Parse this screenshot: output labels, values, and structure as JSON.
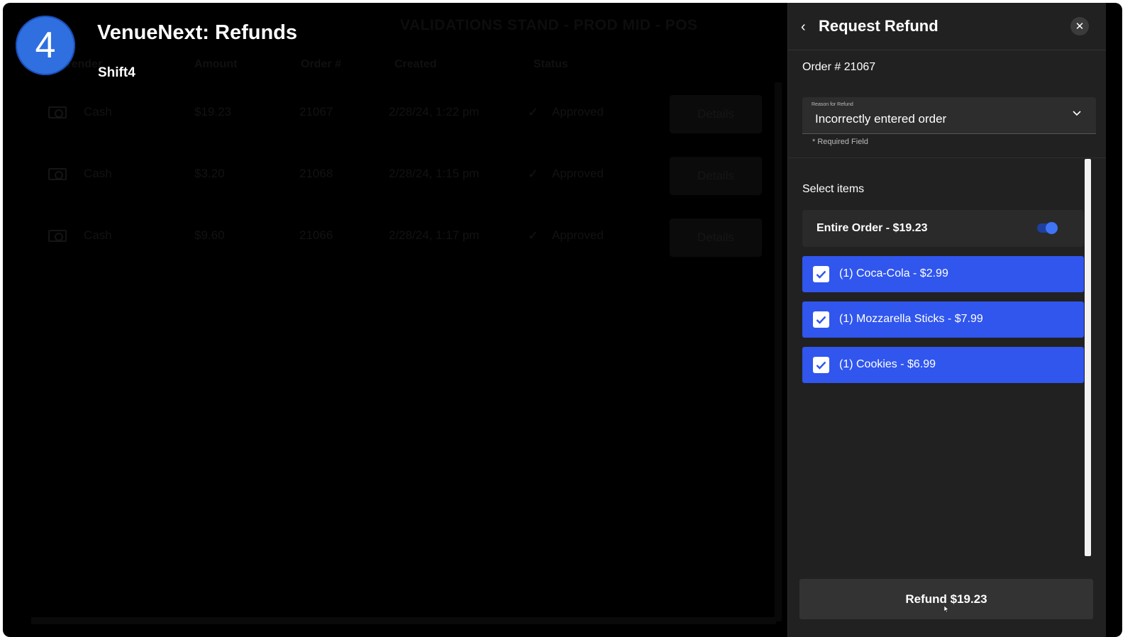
{
  "background": {
    "title": "VALIDATIONS STAND - PROD MID - POS",
    "columns": [
      "Tender",
      "Amount",
      "Order #",
      "Created",
      "Status"
    ],
    "rows": [
      {
        "tender": "Cash",
        "amount": "$19.23",
        "order": "21067",
        "created": "2/28/24, 1:22 pm",
        "status": "Approved",
        "action": "Details"
      },
      {
        "tender": "Cash",
        "amount": "$3.20",
        "order": "21068",
        "created": "2/28/24, 1:15 pm",
        "status": "Approved",
        "action": "Details"
      },
      {
        "tender": "Cash",
        "amount": "$9.60",
        "order": "21066",
        "created": "2/28/24, 1:17 pm",
        "status": "Approved",
        "action": "Details"
      }
    ]
  },
  "overlay": {
    "badge": "4",
    "title": "VenueNext: Refunds",
    "subtitle": "Shift4"
  },
  "panel": {
    "title": "Request Refund",
    "order_label": "Order # 21067",
    "reason": {
      "label": "Reason for Refund",
      "value": "Incorrectly entered order",
      "required": "* Required Field"
    },
    "select_label": "Select items",
    "entire_order": {
      "label": "Entire Order - $19.23",
      "enabled": true
    },
    "items": [
      {
        "label": "(1) Coca-Cola - $2.99",
        "checked": true
      },
      {
        "label": "(1) Mozzarella Sticks - $7.99",
        "checked": true
      },
      {
        "label": "(1) Cookies - $6.99",
        "checked": true
      }
    ],
    "refund_button": "Refund $19.23"
  },
  "colors": {
    "accent": "#3056ee",
    "badge": "#2f6fe0",
    "panel_bg": "#212121"
  }
}
